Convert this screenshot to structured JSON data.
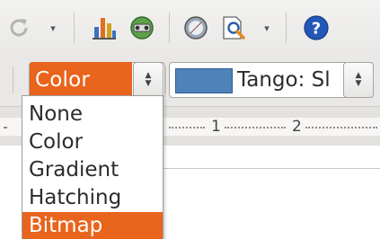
{
  "toolbar": {
    "icons": [
      "redo-icon",
      "chart-icon",
      "navigator-icon",
      "autopilot-icon",
      "zoom-icon",
      "help-icon"
    ]
  },
  "area_bar": {
    "fill_type_value": "Color",
    "color_value": "Tango: Sl",
    "color_swatch": "#4f82b9",
    "accent": "#e9641c"
  },
  "ruler": {
    "labels": [
      "1",
      "2"
    ]
  },
  "fill_type_dropdown": {
    "options": [
      "None",
      "Color",
      "Gradient",
      "Hatching",
      "Bitmap"
    ],
    "selected": "Bitmap"
  }
}
